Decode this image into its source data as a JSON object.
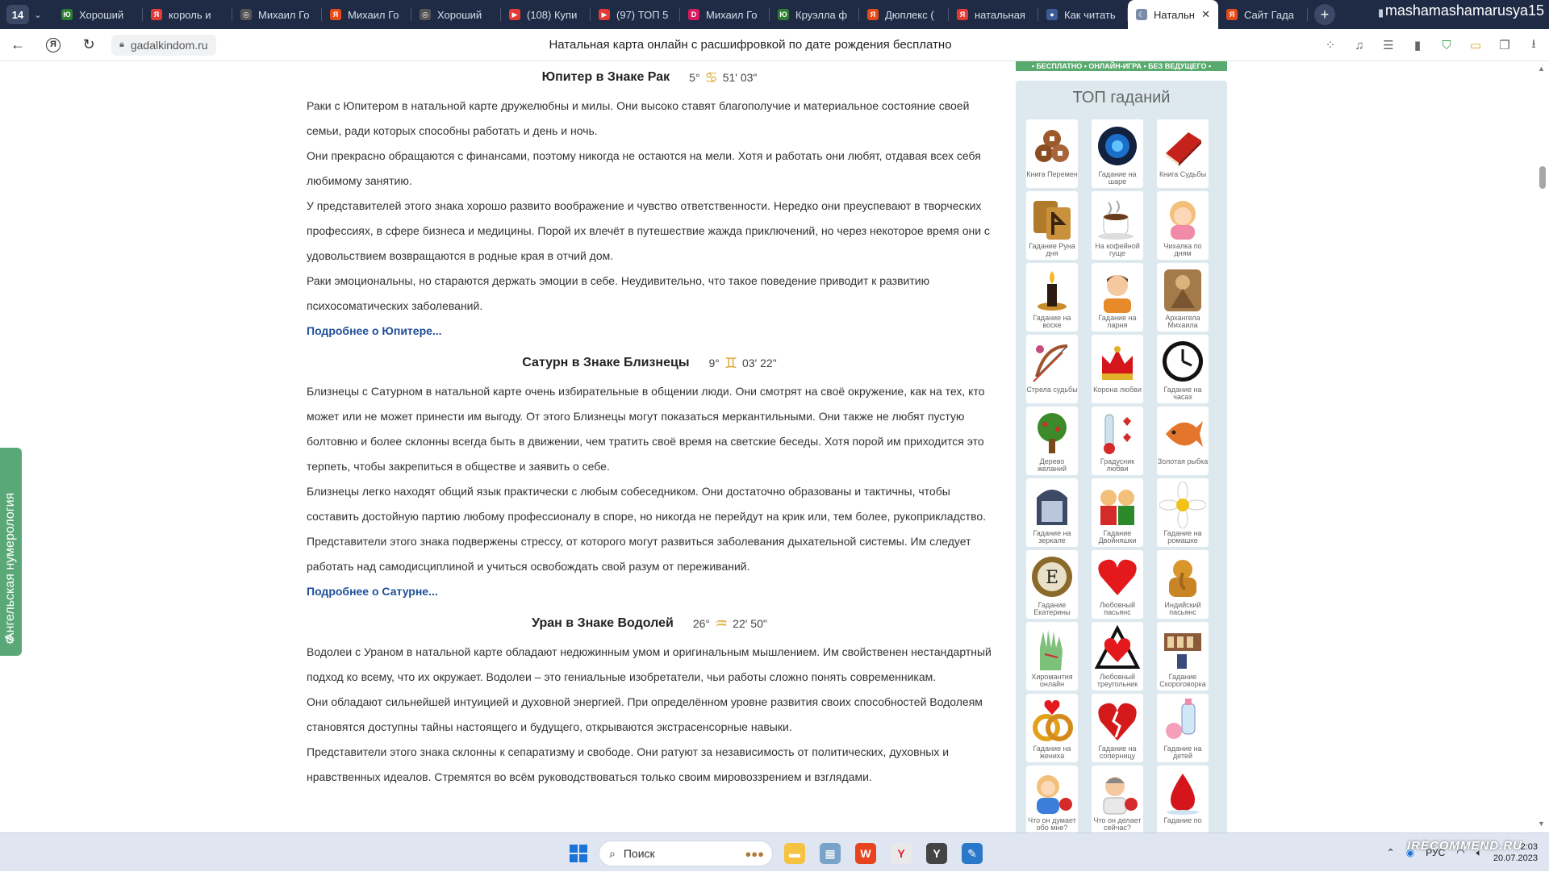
{
  "browser": {
    "tab_count": "14",
    "profile_name": "mashamashamarusya15",
    "tabs": [
      {
        "label": "Хороший",
        "color": "#2e7d32",
        "glyph": "Ю"
      },
      {
        "label": "король и",
        "color": "#e53935",
        "glyph": "Я"
      },
      {
        "label": "Михаил Го",
        "color": "#555555",
        "glyph": "◎"
      },
      {
        "label": "Михаил Го",
        "color": "#e64a19",
        "glyph": "Я"
      },
      {
        "label": "Хороший",
        "color": "#555555",
        "glyph": "◎"
      },
      {
        "label": "(108) Купи",
        "color": "#e53935",
        "glyph": "▶"
      },
      {
        "label": "(97) ТОП 5",
        "color": "#e53935",
        "glyph": "▶"
      },
      {
        "label": "Михаил Го",
        "color": "#d81b60",
        "glyph": "D"
      },
      {
        "label": "Круэлла ф",
        "color": "#2e7d32",
        "glyph": "Ю"
      },
      {
        "label": "Дюплекс (",
        "color": "#e64a19",
        "glyph": "Я"
      },
      {
        "label": "натальная",
        "color": "#e53935",
        "glyph": "Я"
      },
      {
        "label": "Как читать",
        "color": "#3b5b99",
        "glyph": "●"
      },
      {
        "label": "Натальн",
        "color": "#7b8ba8",
        "glyph": "☾",
        "active": true
      },
      {
        "label": "Сайт Гада",
        "color": "#e64a19",
        "glyph": "Я"
      }
    ],
    "url": "gadalkindom.ru",
    "page_title": "Натальная карта онлайн с расшифровкой по дате рождения бесплатно"
  },
  "side_tab": {
    "label": "Ангельская нумерология"
  },
  "content": {
    "sections": [
      {
        "title": "Юпитер в Знаке Рак",
        "deg": "5°",
        "sign": "♋",
        "min": "51' 03\"",
        "paragraphs": [
          "Раки с Юпитером в натальной карте дружелюбны и милы. Они высоко ставят благополучие и материальное состояние своей семьи, ради которых способны работать и день и ночь.",
          "Они прекрасно обращаются с финансами, поэтому никогда не остаются на мели. Хотя и работать они любят, отдавая всех себя любимому занятию.",
          "У представителей этого знака хорошо развито воображение и чувство ответственности. Нередко они преуспевают в творческих профессиях, в сфере бизнеса и медицины. Порой их влечёт в путешествие жажда приключений, но через некоторое время они с удовольствием возвращаются в родные края в отчий дом.",
          "Раки эмоциональны, но стараются держать эмоции в себе. Неудивительно, что такое поведение приводит к развитию психосоматических заболеваний."
        ],
        "more": "Подробнее о Юпитере..."
      },
      {
        "title": "Сатурн в Знаке Близнецы",
        "deg": "9°",
        "sign": "♊",
        "min": "03' 22\"",
        "paragraphs": [
          "Близнецы с Сатурном в натальной карте очень избирательные в общении люди. Они смотрят на своё окружение, как на тех, кто может или не может принести им выгоду. От этого Близнецы могут показаться меркантильными. Они также не любят пустую болтовню и более склонны всегда быть в движении, чем тратить своё время на светские беседы. Хотя порой им приходится это терпеть, чтобы закрепиться в обществе и заявить о себе.",
          "Близнецы легко находят общий язык практически с любым собеседником. Они достаточно образованы и тактичны, чтобы составить достойную партию любому профессионалу в споре, но никогда не перейдут на крик или, тем более, рукоприкладство.",
          "Представители этого знака подвержены стрессу, от которого могут развиться заболевания дыхательной системы. Им следует работать над самодисциплиной и учиться освобождать свой разум от переживаний."
        ],
        "more": "Подробнее о Сатурне..."
      },
      {
        "title": "Уран в Знаке Водолей",
        "deg": "26°",
        "sign": "♒",
        "min": "22' 50\"",
        "paragraphs": [
          "Водолеи с Ураном в натальной карте обладают недюжинным умом и оригинальным мышлением. Им свойственен нестандартный подход ко всему, что их окружает. Водолеи – это гениальные изобретатели, чьи работы сложно понять современникам.",
          "Они обладают сильнейшей интуицией и духовной энергией. При определённом уровне развития своих способностей Водолеям становятся доступны тайны настоящего и будущего, открываются экстрасенсорные навыки.",
          "Представители этого знака склонны к сепаратизму и свободе. Они ратуют за независимость от политических, духовных и нравственных идеалов. Стремятся во всём руководствоваться только своим мировоззрением и взглядами."
        ],
        "more": ""
      }
    ]
  },
  "sidebar": {
    "banner": "• БЕСПЛАТНО • ОНЛАЙН-ИГРА • БЕЗ ВЕДУЩЕГО •",
    "title": "ТОП гаданий",
    "items": [
      {
        "label": "Книга Перемен",
        "icon": "coins-icon"
      },
      {
        "label": "Гадание на шаре",
        "icon": "crystal-ball-icon"
      },
      {
        "label": "Книга Судьбы",
        "icon": "book-icon"
      },
      {
        "label": "Гадание Руна дня",
        "icon": "rune-icon"
      },
      {
        "label": "На кофейной гуще",
        "icon": "coffee-icon"
      },
      {
        "label": "Чихалка по дням",
        "icon": "girl-icon"
      },
      {
        "label": "Гадание на воске",
        "icon": "candle-icon"
      },
      {
        "label": "Гадание на парня",
        "icon": "boy-icon"
      },
      {
        "label": "Архангела Михаила",
        "icon": "archangel-icon"
      },
      {
        "label": "Стрела судьбы",
        "icon": "bow-icon"
      },
      {
        "label": "Корона любви",
        "icon": "crown-icon"
      },
      {
        "label": "Гадание на часах",
        "icon": "clock-icon"
      },
      {
        "label": "Дерево желаний",
        "icon": "tree-icon"
      },
      {
        "label": "Градусник любви",
        "icon": "thermometer-icon"
      },
      {
        "label": "Золотая рыбка",
        "icon": "fish-icon"
      },
      {
        "label": "Гадание на зеркале",
        "icon": "mirror-icon"
      },
      {
        "label": "Гадание Двойняшки",
        "icon": "twins-icon"
      },
      {
        "label": "Гадание на ромашке",
        "icon": "daisy-icon"
      },
      {
        "label": "Гадание Екатерины",
        "icon": "monogram-icon"
      },
      {
        "label": "Любовный пасьянс",
        "icon": "heart-icon"
      },
      {
        "label": "Индийский пасьянс",
        "icon": "ganesha-icon"
      },
      {
        "label": "Хиромантия онлайн",
        "icon": "palm-icon"
      },
      {
        "label": "Любовный треугольник",
        "icon": "love-triangle-icon"
      },
      {
        "label": "Гадание Скороговорка",
        "icon": "cards-icon"
      },
      {
        "label": "Гадание на жениха",
        "icon": "rings-icon"
      },
      {
        "label": "Гадание на соперницу",
        "icon": "broken-heart-icon"
      },
      {
        "label": "Гадание на детей",
        "icon": "baby-bottle-icon"
      },
      {
        "label": "Что он думает обо мне?",
        "icon": "thinking-girl-icon"
      },
      {
        "label": "Что он делает сейчас?",
        "icon": "thinking-man-icon"
      },
      {
        "label": "Гадание по",
        "icon": "drop-icon"
      }
    ]
  },
  "taskbar": {
    "search_placeholder": "Поиск",
    "lang": "РУС",
    "time": "2:03",
    "date": "20.07.2023"
  },
  "watermark": "IRECOMMEND.RU"
}
